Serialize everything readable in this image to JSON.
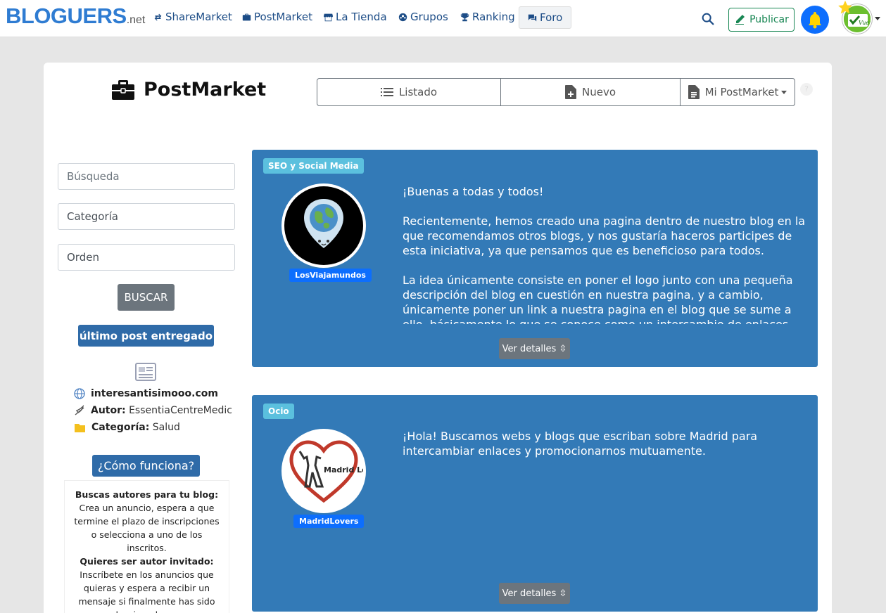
{
  "brand": {
    "name": "BLOGUERS",
    "tld": ".net"
  },
  "nav": {
    "items": [
      {
        "label": "ShareMarket"
      },
      {
        "label": "PostMarket"
      },
      {
        "label": "La Tienda"
      },
      {
        "label": "Grupos"
      },
      {
        "label": "Ranking"
      },
      {
        "label": "Foro"
      }
    ],
    "publicar_label": "Publicar",
    "avatar_text": "Vuena"
  },
  "header": {
    "title": "PostMarket",
    "tabs": [
      {
        "label": "Listado"
      },
      {
        "label": "Nuevo"
      },
      {
        "label": "Mi PostMarket"
      }
    ],
    "help": "?"
  },
  "sidebar": {
    "search_placeholder": "Búsqueda",
    "category_value": "Categoría",
    "order_value": "Orden",
    "buscar_label": "BUSCAR",
    "last_post_label": "último post entregado",
    "last_post": {
      "site": "interesantisimooo.com",
      "author_label": "Autor:",
      "author": "EssentiaCentreMedic",
      "category_label": "Categoría:",
      "category": "Salud"
    },
    "how_label": "¿Cómo funciona?",
    "how": {
      "heading1": "Buscas autores para tu blog:",
      "text1": "Crea un anuncio, espera a que termine el plazo de inscripciones o selecciona a uno de los inscritos.",
      "heading2": "Quieres ser autor invitado:",
      "text2": "Inscríbete en los anuncios que quieras y espera a recibir un mensaje si finalmente has sido seleccionado o no."
    }
  },
  "listings": [
    {
      "category": "SEO y Social Media",
      "blog": "LosViajamundos",
      "paragraphs": [
        "¡Buenas a todas y todos!",
        "Recientemente, hemos creado una pagina dentro de nuestro blog en la que recomendamos otros blogs, y nos gustaría haceros participes de esta iniciativa, ya que pensamos que es beneficioso para todos.",
        "La idea únicamente consiste en poner el logo junto con una pequeña descripción del blog en cuestión en nuestra pagina, y a cambio, únicamente poner un link a nuestra pagina en el blog que se sume a ello, básicamente lo que se conoce como un intercambio de enlaces."
      ],
      "details_label": "Ver detalles ⇳"
    },
    {
      "category": "Ocio",
      "blog": "MadridLovers",
      "avatar_text": "Madrid Lovers",
      "paragraphs": [
        "¡Hola! Buscamos webs y blogs que escriban sobre Madrid para intercambiar enlaces y promocionarnos mutuamente."
      ],
      "details_label": "Ver detalles ⇳"
    }
  ],
  "colors": {
    "brand_blue": "#2f7cd2",
    "listing_blue": "#337ab7",
    "category_badge": "#5bc0de",
    "blog_badge": "#0d6efd",
    "publicar_green": "#198754"
  }
}
